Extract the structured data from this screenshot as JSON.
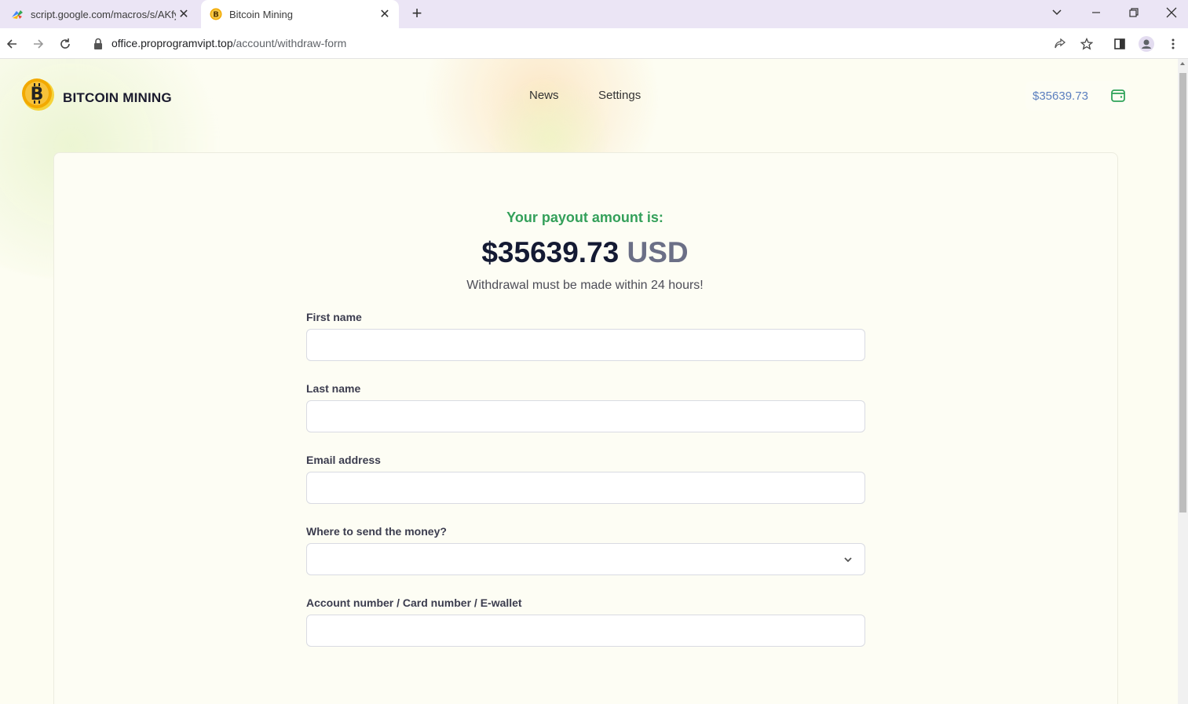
{
  "browser": {
    "tabs": [
      {
        "title": "script.google.com/macros/s/AKfy",
        "favicon": "google-apps-script-icon"
      },
      {
        "title": "Bitcoin Mining",
        "favicon": "bitcoin-icon"
      }
    ],
    "new_tab": "+",
    "url_host": "office.proprogramvipt.top",
    "url_path": "/account/withdraw-form"
  },
  "header": {
    "brand": "BITCOIN MINING",
    "nav": [
      "News",
      "Settings"
    ],
    "balance": "$35639.73"
  },
  "payout": {
    "label": "Your payout amount is:",
    "amount": "$35639.73",
    "currency": "USD",
    "notice": "Withdrawal must be made within 24 hours!"
  },
  "form": {
    "first_name_label": "First name",
    "last_name_label": "Last name",
    "email_label": "Email address",
    "method_label": "Where to send the money?",
    "account_label": "Account number / Card number / E-wallet"
  },
  "colors": {
    "accent_green": "#34a05a",
    "balance_blue": "#5b7fbf",
    "wallet_green": "#2fa35a"
  }
}
